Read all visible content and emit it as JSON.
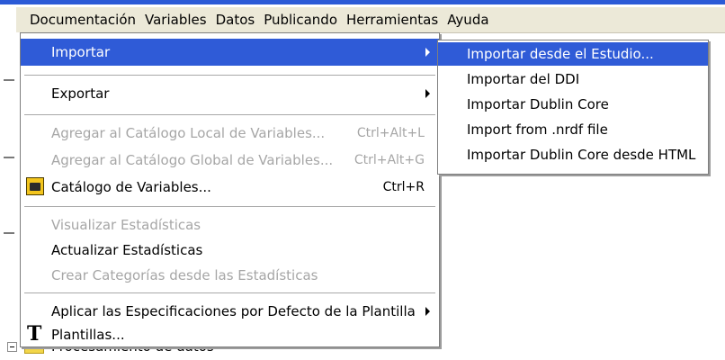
{
  "menubar": {
    "items": [
      "Documentación",
      "Variables",
      "Datos",
      "Publicando",
      "Herramientas",
      "Ayuda"
    ]
  },
  "menu": {
    "importar": "Importar",
    "exportar": "Exportar",
    "agregar_local": "Agregar al Catálogo Local de Variables...",
    "agregar_local_shortcut": "Ctrl+Alt+L",
    "agregar_global": "Agregar al Catálogo Global de Variables...",
    "agregar_global_shortcut": "Ctrl+Alt+G",
    "catalogo": "Catálogo de Variables...",
    "catalogo_shortcut": "Ctrl+R",
    "visualizar": "Visualizar Estadísticas",
    "actualizar": "Actualizar Estadísticas",
    "crear_categorias": "Crear Categorías desde las Estadísticas",
    "aplicar": "Aplicar las Especificaciones por Defecto de la Plantilla",
    "plantillas": "Plantillas..."
  },
  "submenu": {
    "items": [
      "Importar desde el Estudio...",
      "Importar del DDI",
      "Importar Dublin Core",
      "Import from .nrdf file",
      "Importar Dublin Core desde HTML"
    ]
  },
  "background": {
    "tree_item": "Procesamiento de datos"
  },
  "colors": {
    "highlight": "#2f5bd7",
    "menubar": "#ece9d8",
    "disabled_text": "#a6a6a6"
  }
}
